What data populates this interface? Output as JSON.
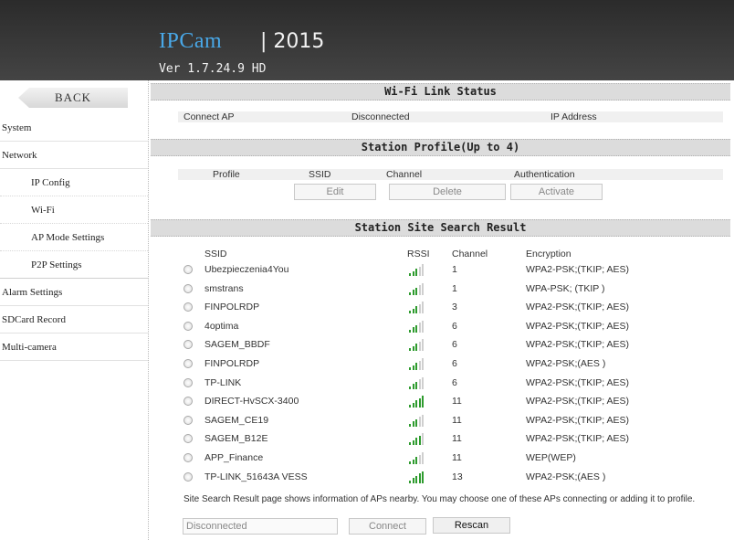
{
  "header": {
    "brand": "IPCam",
    "year": "| 2015",
    "version": "Ver  1.7.24.9 HD"
  },
  "sidebar": {
    "back_label": "BACK",
    "items": [
      {
        "label": "System",
        "level": 1
      },
      {
        "label": "Network",
        "level": 1
      },
      {
        "label": "IP Config",
        "level": 2
      },
      {
        "label": "Wi-Fi",
        "level": 2
      },
      {
        "label": "AP Mode Settings",
        "level": 2
      },
      {
        "label": "P2P Settings",
        "level": 2
      },
      {
        "label": "Alarm Settings",
        "level": 1
      },
      {
        "label": "SDCard Record",
        "level": 1
      },
      {
        "label": "Multi-camera",
        "level": 1
      }
    ]
  },
  "link_status": {
    "title": "Wi-Fi Link Status",
    "connect_ap_label": "Connect AP",
    "connect_ap_value": "Disconnected",
    "ip_label": "IP Address"
  },
  "station_profile": {
    "title": "Station Profile(Up to 4)",
    "columns": {
      "profile": "Profile",
      "ssid": "SSID",
      "channel": "Channel",
      "auth": "Authentication"
    },
    "edit_label": "Edit",
    "delete_label": "Delete",
    "activate_label": "Activate"
  },
  "site_search": {
    "title": "Station Site Search Result",
    "columns": {
      "ssid": "SSID",
      "rssi": "RSSI",
      "channel": "Channel",
      "encryption": "Encryption"
    },
    "rows": [
      {
        "ssid": "Ubezpieczenia4You",
        "rssi_bars": 3,
        "channel": "1",
        "encryption": "WPA2-PSK;(TKIP; AES)"
      },
      {
        "ssid": "smstrans",
        "rssi_bars": 3,
        "channel": "1",
        "encryption": "WPA-PSK; (TKIP )"
      },
      {
        "ssid": "FINPOLRDP",
        "rssi_bars": 3,
        "channel": "3",
        "encryption": "WPA2-PSK;(TKIP; AES)"
      },
      {
        "ssid": "4optima",
        "rssi_bars": 3,
        "channel": "6",
        "encryption": "WPA2-PSK;(TKIP; AES)"
      },
      {
        "ssid": "SAGEM_BBDF",
        "rssi_bars": 3,
        "channel": "6",
        "encryption": "WPA2-PSK;(TKIP; AES)"
      },
      {
        "ssid": "FINPOLRDP",
        "rssi_bars": 3,
        "channel": "6",
        "encryption": "WPA2-PSK;(AES )"
      },
      {
        "ssid": "TP-LINK",
        "rssi_bars": 3,
        "channel": "6",
        "encryption": "WPA2-PSK;(TKIP; AES)"
      },
      {
        "ssid": "DIRECT-HvSCX-3400",
        "rssi_bars": 5,
        "channel": "11",
        "encryption": "WPA2-PSK;(TKIP; AES)"
      },
      {
        "ssid": "SAGEM_CE19",
        "rssi_bars": 3,
        "channel": "11",
        "encryption": "WPA2-PSK;(TKIP; AES)"
      },
      {
        "ssid": "SAGEM_B12E",
        "rssi_bars": 4,
        "channel": "11",
        "encryption": "WPA2-PSK;(TKIP; AES)"
      },
      {
        "ssid": "APP_Finance",
        "rssi_bars": 3,
        "channel": "11",
        "encryption": "WEP(WEP)"
      },
      {
        "ssid": "TP-LINK_51643A VESS",
        "rssi_bars": 5,
        "channel": "13",
        "encryption": "WPA2-PSK;(AES )"
      }
    ],
    "note": "Site Search Result page shows information of APs nearby. You may choose one of these APs connecting or adding it to profile.",
    "status_value": "Disconnected",
    "connect_label": "Connect",
    "rescan_label": "Rescan"
  },
  "colors": {
    "header_bg": "#3a3a3a",
    "brand": "#49a8e8",
    "signal": "#2e9b2e",
    "section_bg": "#dcdcdc"
  }
}
